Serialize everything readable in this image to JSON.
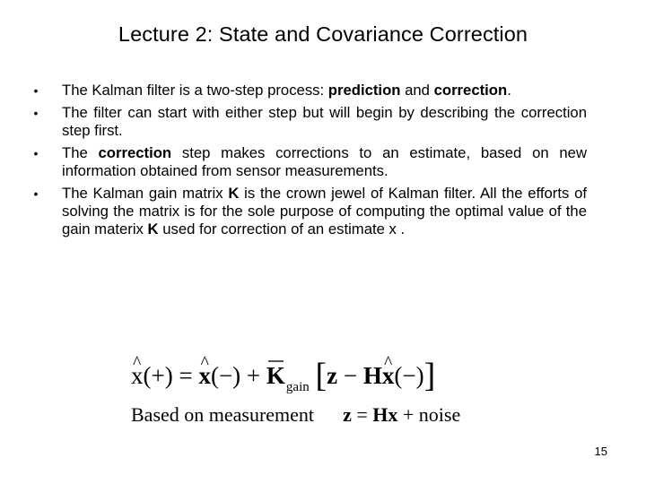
{
  "slide": {
    "title": "Lecture 2: State and Covariance Correction",
    "bullets": [
      {
        "segments": [
          {
            "text": "The Kalman filter is a two-step process: ",
            "bold": false
          },
          {
            "text": "prediction",
            "bold": true
          },
          {
            "text": " and ",
            "bold": false
          },
          {
            "text": "correction",
            "bold": true
          },
          {
            "text": ".",
            "bold": false
          }
        ]
      },
      {
        "segments": [
          {
            "text": "The filter can start with either step but will begin by describing the correction step first.",
            "bold": false
          }
        ]
      },
      {
        "segments": [
          {
            "text": "The ",
            "bold": false
          },
          {
            "text": "correction",
            "bold": true
          },
          {
            "text": " step makes corrections to an estimate, based on new information obtained from sensor measurements.",
            "bold": false
          }
        ]
      },
      {
        "segments": [
          {
            "text": "The Kalman gain matrix ",
            "bold": false
          },
          {
            "text": "K",
            "bold": true
          },
          {
            "text": " is the crown jewel of Kalman filter. All the efforts of solving the matrix is for the sole purpose of computing the optimal value of the gain materix ",
            "bold": false
          },
          {
            "text": "K",
            "bold": true
          },
          {
            "text": " used for correction of an estimate x .",
            "bold": false
          }
        ]
      }
    ],
    "bullet_glyph": "•",
    "equation1": {
      "lhs_var": "x",
      "lhs_arg": "(+)",
      "equals": " = ",
      "prior_var": "x",
      "prior_arg": "(−)",
      "plus": " + ",
      "gain_symbol": "K",
      "gain_subscript": "gain",
      "bracket_open": "[",
      "innovation_z": "z",
      "minus": " − ",
      "H": "H",
      "inner_var": "x",
      "inner_arg": "(−)",
      "bracket_close": "]"
    },
    "equation2": {
      "label": "Based on measurement",
      "z": "z",
      "equals": " = ",
      "Hx": "Hx",
      "rest": " + noise"
    },
    "page_number": "15"
  }
}
